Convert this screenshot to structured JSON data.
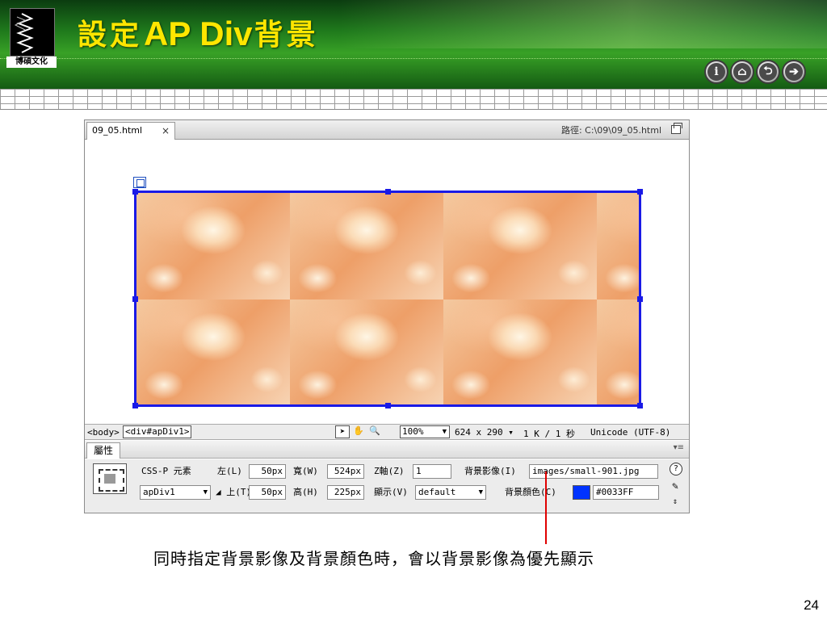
{
  "slide": {
    "title": {
      "prefix": "設定",
      "latin": "AP Div",
      "suffix": "背景"
    },
    "logo_caption": "博碩文化",
    "nav_buttons": [
      {
        "name": "info",
        "glyph": "i"
      },
      {
        "name": "home",
        "glyph": "⌂"
      },
      {
        "name": "back",
        "glyph": "⮌"
      },
      {
        "name": "forward",
        "glyph": "➔"
      }
    ],
    "caption": "同時指定背景影像及背景顏色時，會以背景影像為優先顯示",
    "page_number": "24"
  },
  "document": {
    "tab_name": "09_05.html",
    "close_glyph": "×",
    "path_label": "路徑:  C:\\09\\09_05.html"
  },
  "statusbar": {
    "tag_body": "<body>",
    "tag_div": "<div#apDiv1>",
    "zoom": "100%",
    "size": "624 x 290",
    "kb": "1 K / 1 秒",
    "encoding": "Unicode (UTF-8)"
  },
  "properties": {
    "tab_label": "屬性",
    "menu_glyph": "▾≡",
    "element_type_label": "CSS-P 元素",
    "element_id": "apDiv1",
    "left_label": "左(L)",
    "left_value": "50px",
    "top_label": "上(T)",
    "top_value": "50px",
    "width_label": "寬(W)",
    "width_value": "524px",
    "height_label": "高(H)",
    "height_value": "225px",
    "zindex_label": "Z軸(Z)",
    "zindex_value": "1",
    "visibility_label": "顯示(V)",
    "visibility_value": "default",
    "bg_image_label": "背景影像(I)",
    "bg_image_value": "images/small-901.jpg",
    "bg_color_label": "背景顏色(C)",
    "bg_color_value": "#0033FF"
  },
  "colors": {
    "banner_green": "#1f7a1c",
    "title_yellow": "#ffe600",
    "selection_blue": "#1a1ae6",
    "callout_red": "#e00000",
    "bg_color_swatch": "#0033ff"
  },
  "icons": {
    "select_tool": "pointer-arrow-icon",
    "hand_tool": "hand-icon",
    "zoom_tool": "magnifier-icon",
    "help": "help-icon",
    "edit": "edit-icon"
  }
}
